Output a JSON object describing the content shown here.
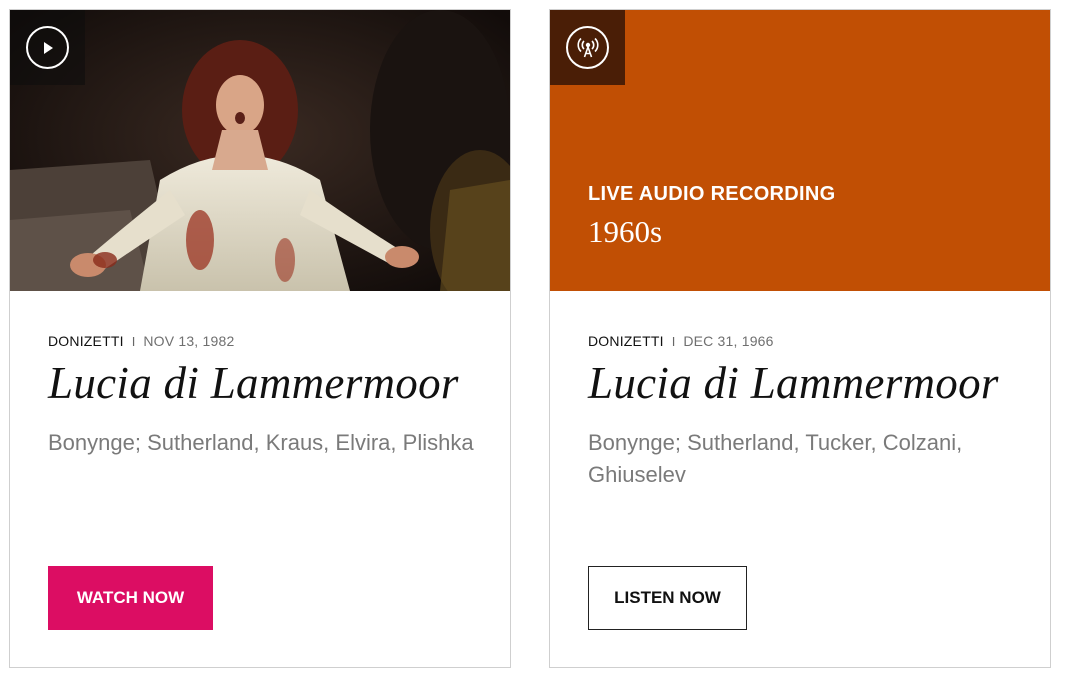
{
  "cards": [
    {
      "media_icon": "play-icon",
      "composer": "DONIZETTI",
      "separator": "I",
      "date": "NOV 13, 1982",
      "title": "Lucia di Lammermoor",
      "cast": "Bonynge; Sutherland, Kraus, Elvira, Plishka",
      "cta_label": "WATCH NOW",
      "cta_color": "#dc0d63"
    },
    {
      "media_icon": "radio-broadcast-icon",
      "hero_label": "LIVE AUDIO RECORDING",
      "hero_decade": "1960s",
      "hero_color": "#c14f04",
      "composer": "DONIZETTI",
      "separator": "I",
      "date": "DEC 31, 1966",
      "title": "Lucia di Lammermoor",
      "cast": "Bonynge; Sutherland, Tucker, Colzani, Ghiuselev",
      "cta_label": "LISTEN NOW"
    }
  ]
}
